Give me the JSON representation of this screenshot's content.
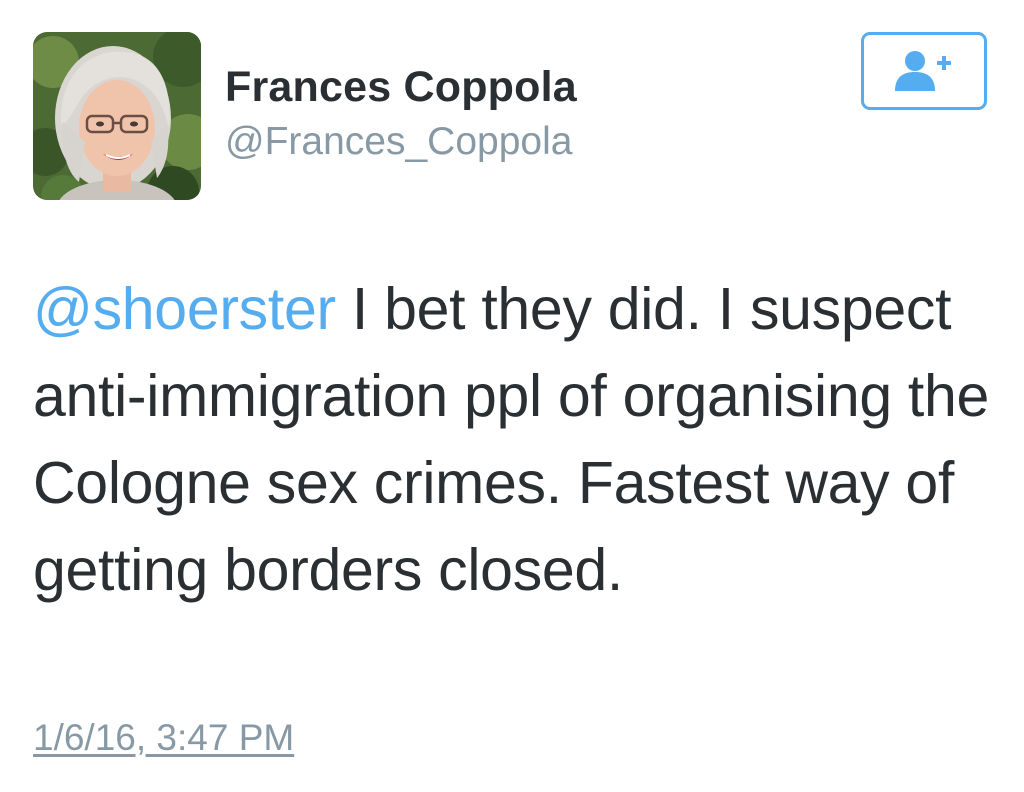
{
  "user": {
    "display_name": "Frances Coppola",
    "handle": "@Frances_Coppola",
    "avatar": "profile-photo"
  },
  "follow_button": {
    "icon": "follow-user-plus-icon",
    "color": "#55acee"
  },
  "tweet": {
    "mention": "@shoerster",
    "text": " I bet they did. I suspect anti-immigration ppl of organising the Cologne sex crimes. Fastest way of getting borders closed.",
    "timestamp": "1/6/16, 3:47 PM"
  },
  "colors": {
    "text": "#292f33",
    "secondary": "#8899a6",
    "link": "#55acee"
  }
}
